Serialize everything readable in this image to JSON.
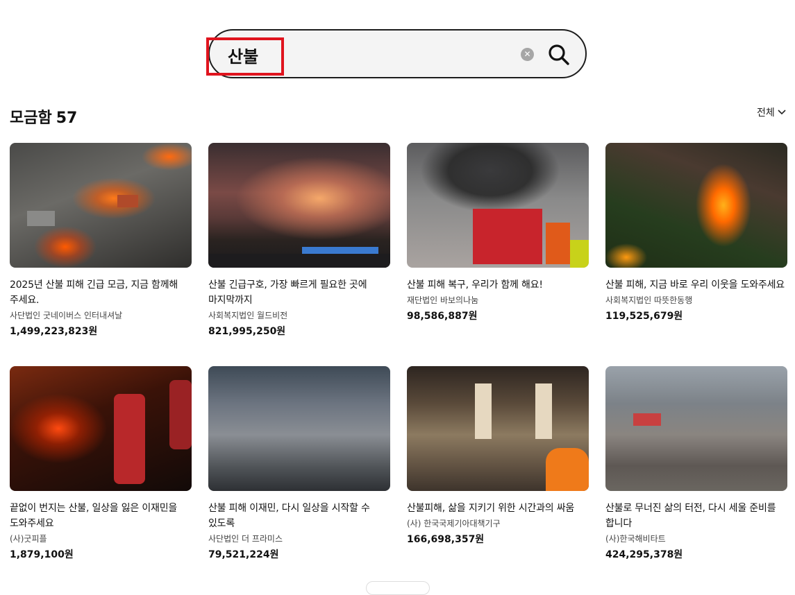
{
  "search": {
    "value": "산불",
    "placeholder": "",
    "clear_icon": "clear-icon",
    "search_icon": "search-icon",
    "highlight_color": "#e0141e"
  },
  "results": {
    "title": "모금함",
    "count": "57",
    "filter_label": "전체",
    "filter_icon": "chevron-down-icon"
  },
  "cards": [
    {
      "title": "2025년 산불 피해 긴급 모금, 지금 함께해 주세요.",
      "org": "사단법인 굿네이버스 인터내셔날",
      "amount": "1,499,223,823원"
    },
    {
      "title": "산불 긴급구호, 가장 빠르게 필요한 곳에 마지막까지",
      "org": "사회복지법인 월드비전",
      "amount": "821,995,250원"
    },
    {
      "title": "산불 피해 복구, 우리가 함께 해요!",
      "org": "재단법인 바보의나눔",
      "amount": "98,586,887원"
    },
    {
      "title": "산불 피해, 지금 바로 우리 이웃을 도와주세요",
      "org": "사회복지법인 따뜻한동행",
      "amount": "119,525,679원"
    },
    {
      "title": "끝없이 번지는 산불, 일상을 잃은 이재민을 도와주세요",
      "org": "(사)굿피플",
      "amount": "1,879,100원"
    },
    {
      "title": "산불 피해 이재민, 다시 일상을 시작할 수 있도록",
      "org": "사단법인 더 프라미스",
      "amount": "79,521,224원"
    },
    {
      "title": "산불피해, 삶을 지키기 위한 시간과의 싸움",
      "org": "(사) 한국국제기아대책기구",
      "amount": "166,698,357원"
    },
    {
      "title": "산불로 무너진 삶의 터전, 다시 세울 준비를 합니다",
      "org": "(사)한국해비타트",
      "amount": "424,295,378원"
    }
  ]
}
